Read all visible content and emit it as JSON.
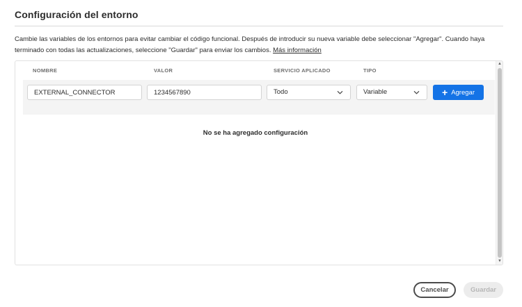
{
  "dialog": {
    "title": "Configuración del entorno",
    "description": "Cambie las variables de los entornos para evitar cambiar el código funcional. Después de introducir su nueva variable debe seleccionar \"Agregar\". Cuando haya terminado con todas las actualizaciones, seleccione \"Guardar\" para enviar los cambios.",
    "more_info_link": "Más información"
  },
  "table": {
    "headers": {
      "name": "NOMBRE",
      "value": "VALOR",
      "service": "SERVICIO APLICADO",
      "type": "TIPO"
    },
    "form": {
      "name_value": "EXTERNAL_CONNECTOR",
      "value_value": "1234567890",
      "service_selected": "Todo",
      "type_selected": "Variable",
      "add_label": "Agregar"
    },
    "empty_message": "No se ha agregado configuración"
  },
  "footer": {
    "cancel_label": "Cancelar",
    "save_label": "Guardar"
  },
  "colors": {
    "accent": "#1473e6",
    "disabled_bg": "#ececec",
    "disabled_text": "#b6b6b6"
  },
  "icons": {
    "add": "plus-icon",
    "dropdown": "chevron-down-icon"
  }
}
